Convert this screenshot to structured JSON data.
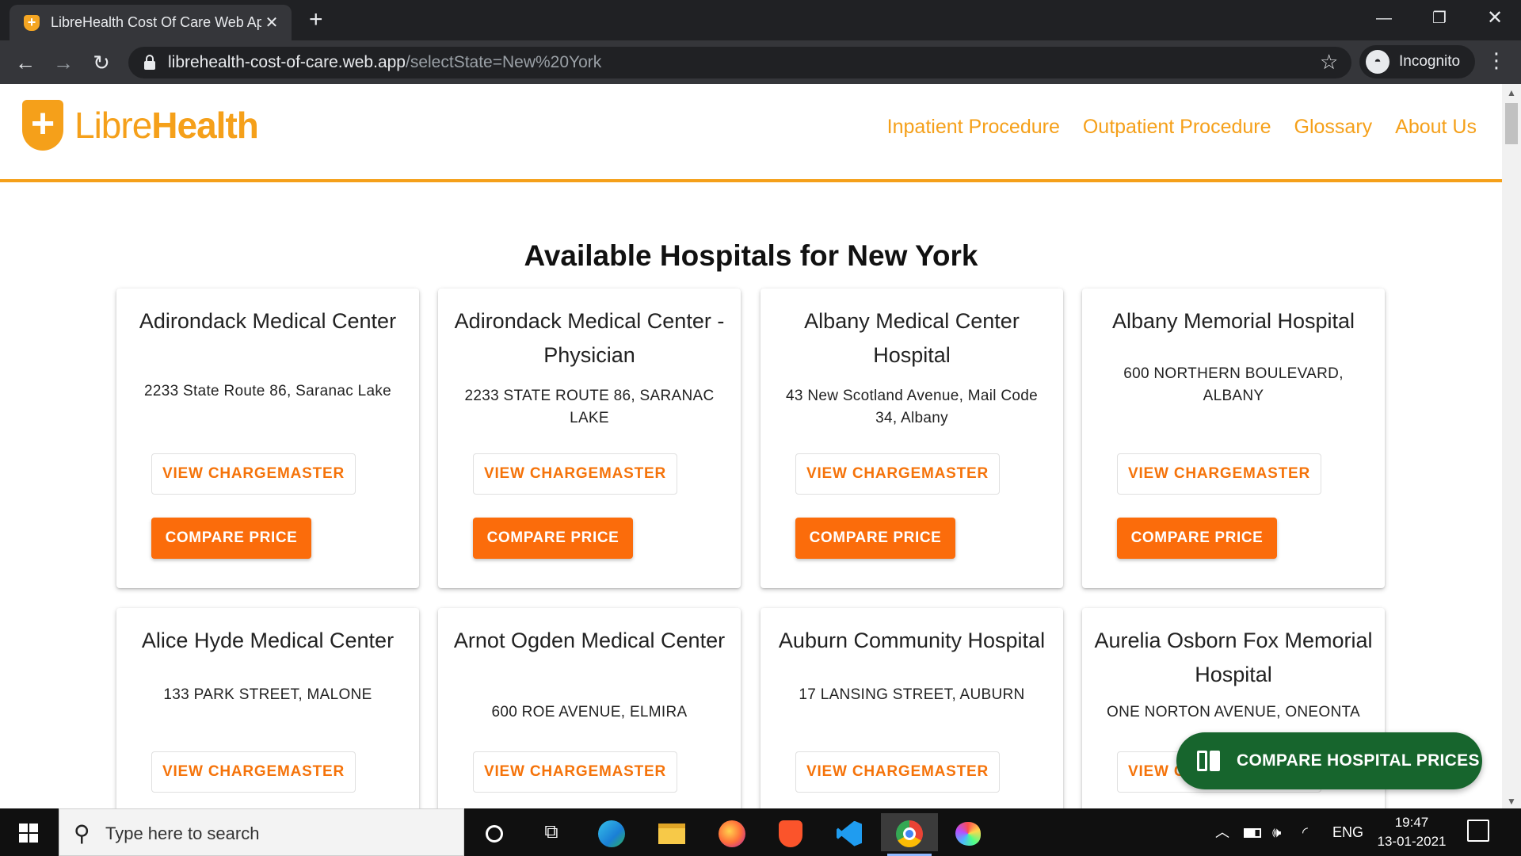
{
  "browser": {
    "tab_title": "LibreHealth Cost Of Care Web Ap",
    "tab_close": "✕",
    "new_tab": "+",
    "url_host": "librehealth-cost-of-care.web.app",
    "url_path": "/selectState=New%20York",
    "incognito_label": "Incognito",
    "nav_back": "←",
    "nav_forward": "→",
    "nav_reload": "↻",
    "star": "☆",
    "menu": "⋮",
    "window_minimize": "—",
    "window_restore": "❐",
    "window_close": "✕"
  },
  "site": {
    "logo_light": "Libre",
    "logo_bold": "Health",
    "logo_glyph": "+",
    "nav": [
      "Inpatient Procedure",
      "Outpatient Procedure",
      "Glossary",
      "About Us"
    ],
    "brand_color": "#f5a01a",
    "button_color": "#fb6c0b"
  },
  "main": {
    "title": "Available Hospitals for New York",
    "view_label": "VIEW CHARGEMASTER",
    "compare_label": "COMPARE PRICE",
    "hospitals": [
      {
        "name": "Adirondack Medical Center",
        "address": "2233 State Route 86, Saranac Lake"
      },
      {
        "name": "Adirondack Medical Center - Physician",
        "address": "2233 STATE ROUTE 86, SARANAC LAKE"
      },
      {
        "name": "Albany Medical Center Hospital",
        "address": "43 New Scotland Avenue, Mail Code 34, Albany"
      },
      {
        "name": "Albany Memorial Hospital",
        "address": "600 NORTHERN BOULEVARD, ALBANY"
      },
      {
        "name": "Alice Hyde Medical Center",
        "address": "133 PARK STREET, MALONE"
      },
      {
        "name": "Arnot Ogden Medical Center",
        "address": "600 ROE AVENUE, ELMIRA"
      },
      {
        "name": "Auburn Community Hospital",
        "address": "17 LANSING STREET, AUBURN"
      },
      {
        "name": "Aurelia Osborn Fox Memorial Hospital",
        "address": "ONE NORTON AVENUE, ONEONTA"
      }
    ],
    "fab_label": "COMPARE HOSPITAL PRICES",
    "fab_color": "#17652d"
  },
  "taskbar": {
    "search_placeholder": "Type here to search",
    "apps": [
      "cortana",
      "task-view",
      "edge",
      "file-explorer",
      "firefox",
      "brave",
      "vscode",
      "chrome",
      "paint"
    ],
    "language": "ENG",
    "time": "19:47",
    "date": "13-01-2021"
  }
}
